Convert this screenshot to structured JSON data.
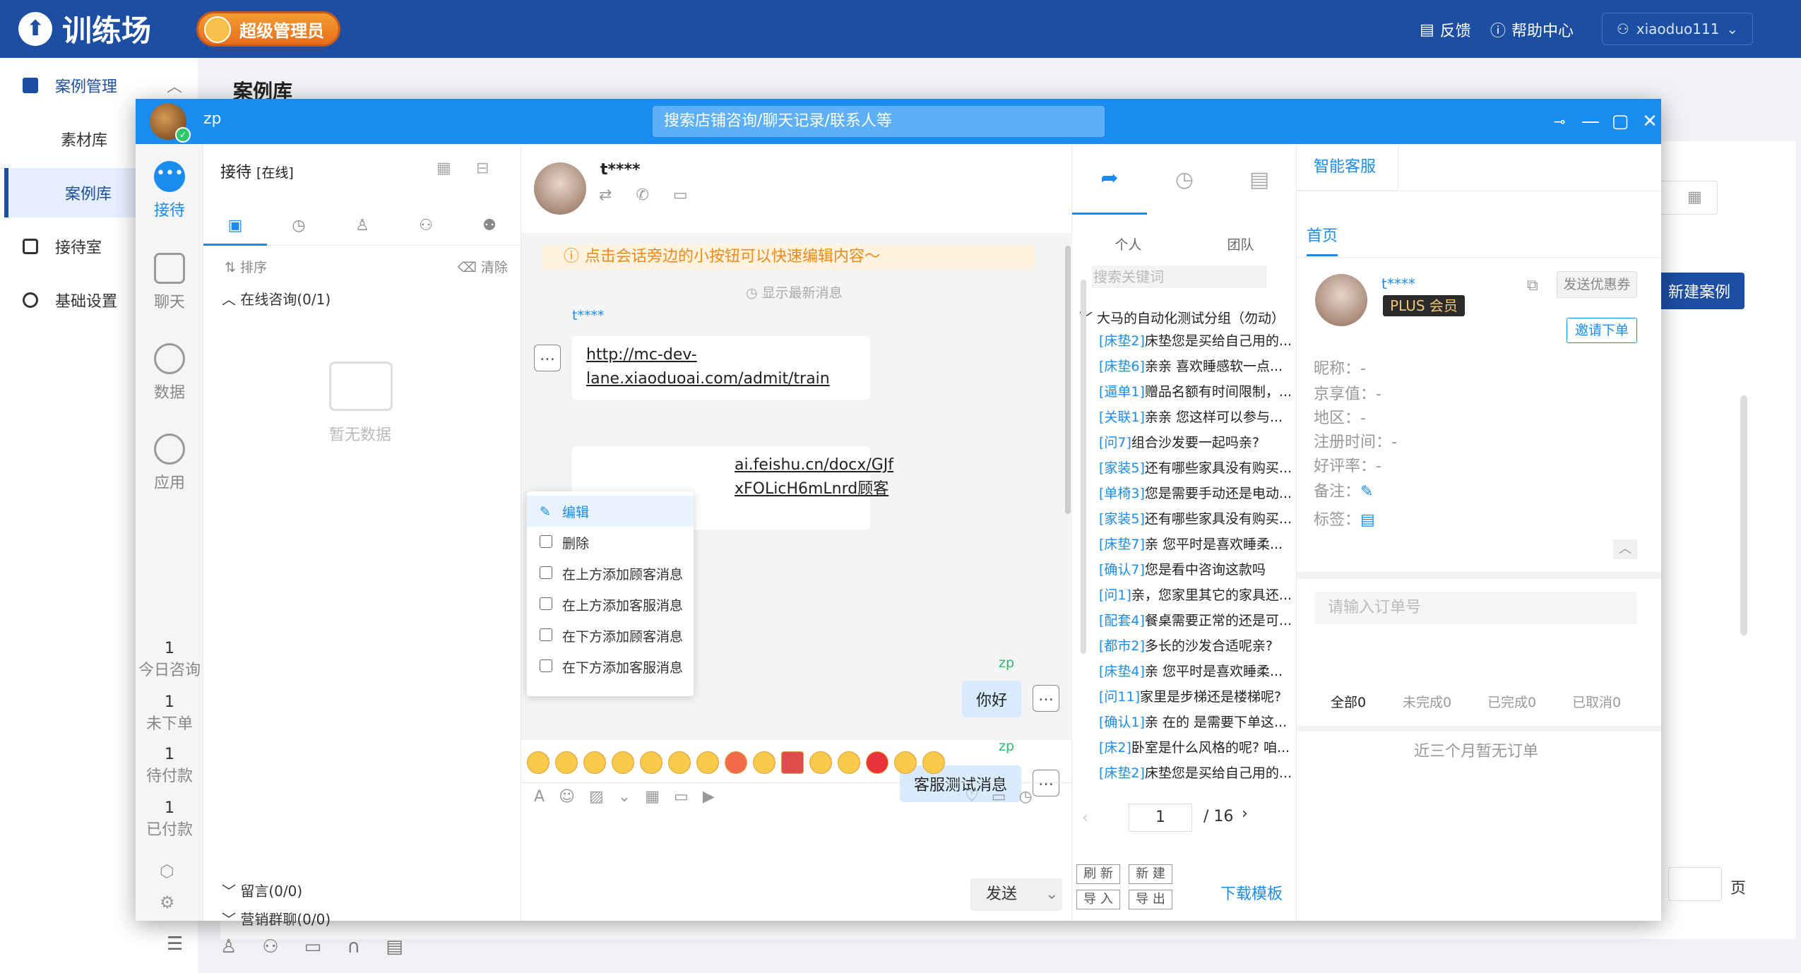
{
  "app": {
    "logo_text": "训练场",
    "admin_badge": "超级管理员",
    "feedback": "反馈",
    "help": "帮助中心",
    "username": "xiaoduo111"
  },
  "nav": {
    "items": [
      {
        "label": "案例管理"
      },
      {
        "label": "素材库"
      },
      {
        "label": "案例库"
      },
      {
        "label": "接待室"
      },
      {
        "label": "基础设置"
      }
    ]
  },
  "page": {
    "title": "案例库",
    "new_case": "新建案例",
    "page_suffix": "页"
  },
  "window": {
    "name": "zp",
    "search_placeholder": "搜索店铺咨询/聊天记录/联系人等"
  },
  "rail": {
    "items": [
      "接待",
      "聊天",
      "数据",
      "应用"
    ],
    "stats": [
      {
        "value": "1",
        "label": "今日咨询"
      },
      {
        "value": "1",
        "label": "未下单"
      },
      {
        "value": "1",
        "label": "待付款"
      },
      {
        "value": "1",
        "label": "已付款"
      }
    ]
  },
  "sessions": {
    "title": "接待",
    "status": "[在线]",
    "sort": "排序",
    "clear": "清除",
    "online_group": "在线咨询(0/1)",
    "empty": "暂无数据",
    "message_group": "留言(0/0)",
    "marketing_group": "营销群聊(0/0)"
  },
  "chat": {
    "contact": "t****",
    "tip": "点击会话旁边的小按钮可以快速编辑内容～",
    "show_latest": "显示最新消息",
    "customer_name": "t****",
    "msg1_line1": "http://mc-dev-",
    "msg1_line2": "lane.xiaoduoai.com/admit/train",
    "msg2_line1": "ai.feishu.cn/docx/GJf",
    "msg2_line2": "xFOLicH6mLnrd顾客",
    "agent_name1": "zp",
    "agent_msg1": "你好",
    "agent_name2": "zp",
    "agent_msg2": "客服测试消息",
    "send": "发送"
  },
  "context_menu": {
    "items": [
      "编辑",
      "删除",
      "在上方添加顾客消息",
      "在上方添加客服消息",
      "在下方添加顾客消息",
      "在下方添加客服消息"
    ]
  },
  "quick_reply": {
    "tabs": [
      "个人",
      "团队"
    ],
    "search_placeholder": "搜索关键词",
    "group": "大马的自动化测试分组（勿动）",
    "items": [
      {
        "tag": "[床垫2]",
        "text": "床垫您是买给自己用的..."
      },
      {
        "tag": "[床垫6]",
        "text": "亲亲 喜欢睡感软一点..."
      },
      {
        "tag": "[逼单1]",
        "text": "赠品名额有时间限制，..."
      },
      {
        "tag": "[关联1]",
        "text": "亲亲 您这样可以参与..."
      },
      {
        "tag": "[问7]",
        "text": "组合沙发要一起吗亲?"
      },
      {
        "tag": "[家装5]",
        "text": "还有哪些家具没有购买..."
      },
      {
        "tag": "[单椅3]",
        "text": "您是需要手动还是电动..."
      },
      {
        "tag": "[家装5]",
        "text": "还有哪些家具没有购买..."
      },
      {
        "tag": "[床垫7]",
        "text": "亲 您平时是喜欢睡柔..."
      },
      {
        "tag": "[确认7]",
        "text": "您是看中咨询这款吗"
      },
      {
        "tag": "[问1]",
        "text": "亲，您家里其它的家具还..."
      },
      {
        "tag": "[配套4]",
        "text": "餐桌需要正常的还是可..."
      },
      {
        "tag": "[都市2]",
        "text": "多长的沙发合适呢亲?"
      },
      {
        "tag": "[床垫4]",
        "text": "亲 您平时是喜欢睡柔..."
      },
      {
        "tag": "[问11]",
        "text": "家里是步梯还是楼梯呢?"
      },
      {
        "tag": "[确认1]",
        "text": "亲 在的 是需要下单这..."
      },
      {
        "tag": "[床2]",
        "text": "卧室是什么风格的呢? 咱..."
      },
      {
        "tag": "[床垫2]",
        "text": "床垫您是买给自己用的..."
      }
    ],
    "page_current": "1",
    "page_total": "/ 16",
    "btn_refresh": "刷 新",
    "btn_new": "新 建",
    "btn_import": "导 入",
    "btn_export": "导 出",
    "download_template": "下载模板"
  },
  "smart": {
    "title": "智能客服",
    "home_tab": "首页",
    "customer": "t****",
    "plus_badge": "PLUS 会员",
    "send_coupon": "发送优惠券",
    "invite_order": "邀请下单",
    "fields": [
      "昵称：-",
      "京享值：-",
      "地区：-",
      "注册时间：-",
      "好评率：-",
      "备注：",
      "标签："
    ],
    "order_placeholder": "请输入订单号",
    "order_tabs": [
      "全部0",
      "未完成0",
      "已完成0",
      "已取消0"
    ],
    "no_orders": "近三个月暂无订单"
  }
}
